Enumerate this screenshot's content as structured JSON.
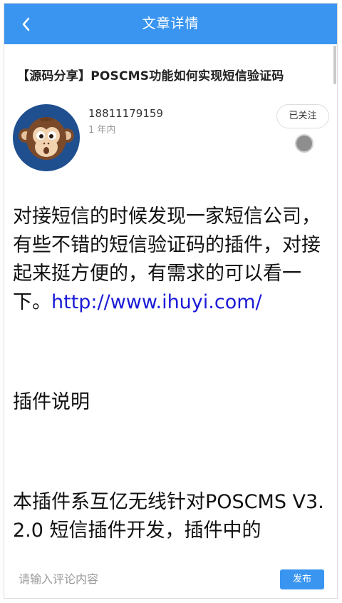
{
  "header": {
    "title": "文章详情",
    "back_icon": "chevron-left-icon",
    "background_color": "#3a95f0"
  },
  "article": {
    "title": "【源码分享】POSCMS功能如何实现短信验证码",
    "author": {
      "name": "18811179159",
      "time": "1 年内",
      "avatar": "monkey-avatar"
    },
    "follow_label": "已关注",
    "body": {
      "p1_text": "对接短信的时候发现一家短信公司，有些不错的短信验证码的插件，对接起来挺方便的，有需求的可以看一下。",
      "p1_link": "http://www.ihuyi.com/",
      "p2": "插件说明",
      "p3": "本插件系互亿无线针对POSCMS V3.2.0 短信插件开发，插件中的"
    }
  },
  "comment": {
    "placeholder": "请输入评论内容",
    "publish_label": "发布"
  }
}
